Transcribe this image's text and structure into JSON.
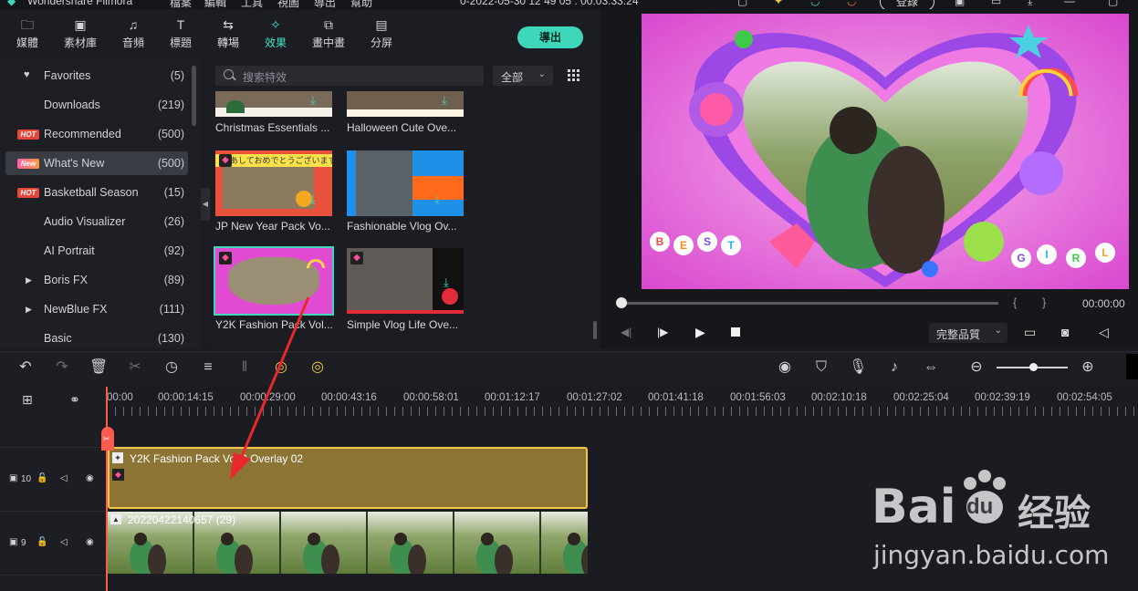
{
  "app": {
    "title": "Wondershare Filmora",
    "login_label": "登錄",
    "timestamp": "0-2022-05-30 12 49 05 : 00:03:33:24"
  },
  "menu": [
    "檔案",
    "編輯",
    "工具",
    "視圖",
    "導出",
    "幫助"
  ],
  "tabs": [
    {
      "label": "媒體",
      "icon": "folder-icon"
    },
    {
      "label": "素材庫",
      "icon": "image-icon"
    },
    {
      "label": "音頻",
      "icon": "music-icon"
    },
    {
      "label": "標題",
      "icon": "text-icon"
    },
    {
      "label": "轉場",
      "icon": "transition-icon"
    },
    {
      "label": "效果",
      "icon": "effects-icon",
      "active": true
    },
    {
      "label": "畫中畫",
      "icon": "pip-icon"
    },
    {
      "label": "分屏",
      "icon": "split-screen-icon"
    }
  ],
  "export_label": "導出",
  "sidebar": {
    "items": [
      {
        "label": "Favorites",
        "count": "(5)",
        "icon": "heart-icon"
      },
      {
        "label": "Downloads",
        "count": "(219)"
      },
      {
        "label": "Recommended",
        "count": "(500)",
        "badge": "HOT"
      },
      {
        "label": "What's New",
        "count": "(500)",
        "badge": "New",
        "selected": true
      },
      {
        "label": "Basketball Season",
        "count": "(15)",
        "badge": "HOT"
      },
      {
        "label": "Audio Visualizer",
        "count": "(26)"
      },
      {
        "label": "AI Portrait",
        "count": "(92)"
      },
      {
        "label": "Boris FX",
        "count": "(89)",
        "expand": true
      },
      {
        "label": "NewBlue FX",
        "count": "(111)",
        "expand": true
      },
      {
        "label": "Basic",
        "count": "(130)"
      }
    ]
  },
  "search": {
    "placeholder": "搜索特效"
  },
  "filter": {
    "value": "全部"
  },
  "effects": [
    {
      "label": "Christmas Essentials ..."
    },
    {
      "label": "Halloween Cute Ove..."
    },
    {
      "label": "JP New Year Pack Vo..."
    },
    {
      "label": "Fashionable Vlog Ov..."
    },
    {
      "label": "Y2K Fashion Pack Vol...",
      "selected": true
    },
    {
      "label": "Simple Vlog Life Ove..."
    }
  ],
  "jp_thumb_text": "あしておめでとうございます",
  "preview": {
    "timecode": "00:00:00",
    "quality": "完整品質",
    "letters_left": [
      "B",
      "E",
      "S",
      "T"
    ],
    "letters_right": [
      "G",
      "I",
      "R",
      "L"
    ]
  },
  "ruler": {
    "labels": [
      "00:00",
      "00:00:14:15",
      "00:00:29:00",
      "00:00:43:16",
      "00:00:58:01",
      "00:01:12:17",
      "00:01:27:02",
      "00:01:41:18",
      "00:01:56:03",
      "00:02:10:18",
      "00:02:25:04",
      "00:02:39:19",
      "00:02:54:05"
    ]
  },
  "tracks": [
    {
      "number": "10",
      "clip_label": "Y2K Fashion Pack Vol 2 Overlay 02"
    },
    {
      "number": "9",
      "clip_label": "20220422140657 (29)"
    }
  ],
  "watermark": {
    "brand": "Bai",
    "brand2": "du",
    "cn": "经验",
    "url": "jingyan.baidu.com"
  },
  "colors": {
    "accent": "#3fd7ba",
    "playhead": "#ff5a4e",
    "overlay_clip": "#8c7434",
    "clip_border": "#f2c94c",
    "arrow": "#e8282b"
  }
}
